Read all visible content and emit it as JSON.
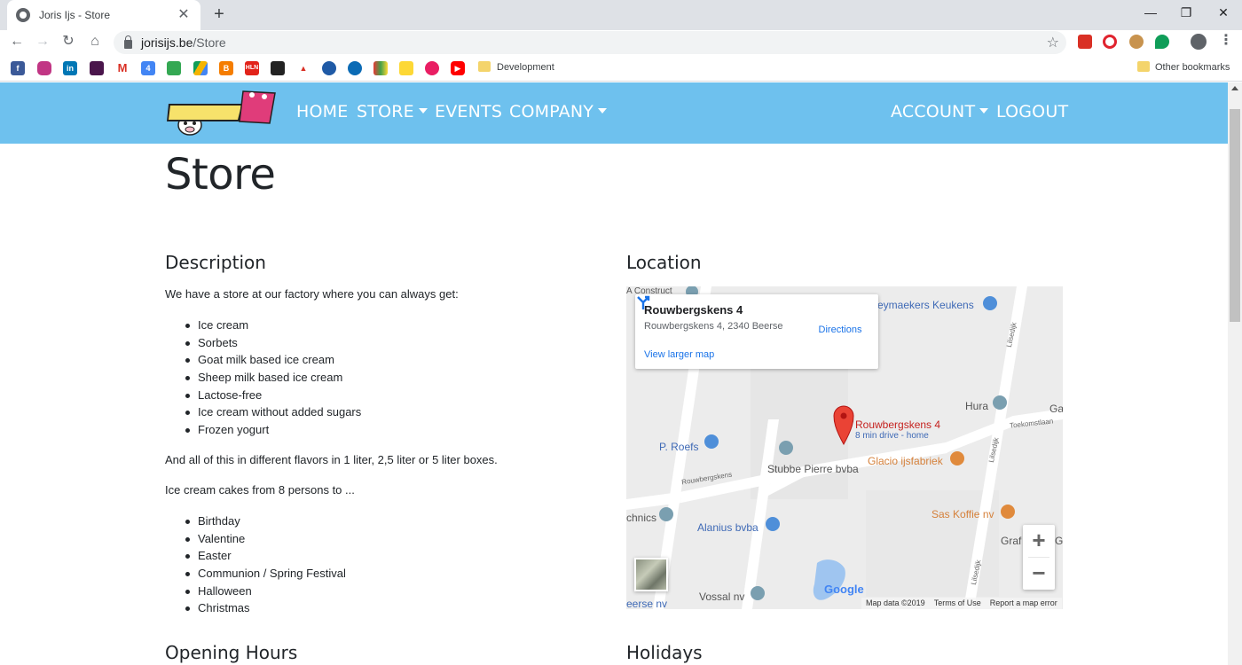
{
  "browser": {
    "tab_title": "Joris Ijs - Store",
    "tab_close": "✕",
    "new_tab": "+",
    "url_host": "jorisijs.be",
    "url_path": "/Store",
    "bookmarks": {
      "development": "Development",
      "other": "Other bookmarks"
    },
    "window": {
      "minimize": "—",
      "restore": "❐",
      "close": "✕"
    }
  },
  "site": {
    "nav": {
      "home": "HOME",
      "store": "STORE",
      "events": "EVENTS",
      "company": "COMPANY",
      "account": "ACCOUNT",
      "logout": "LOGOUT"
    },
    "page_title": "Store"
  },
  "description": {
    "heading": "Description",
    "intro": "We have a store at our factory where you can always get:",
    "items": [
      "Ice cream",
      "Sorbets",
      "Goat milk based ice cream",
      "Sheep milk based ice cream",
      "Lactose-free",
      "Ice cream without added sugars",
      "Frozen yogurt"
    ],
    "flavors": "And all of this in different flavors in 1 liter, 2,5 liter or 5 liter boxes.",
    "cakes_intro": "Ice cream cakes from 8 persons to ...",
    "cake_items": [
      "Birthday",
      "Valentine",
      "Easter",
      "Communion / Spring Festival",
      "Halloween",
      "Christmas"
    ]
  },
  "location": {
    "heading": "Location",
    "card": {
      "name": "Rouwbergskens 4",
      "address": "Rouwbergskens 4, 2340 Beerse",
      "directions": "Directions",
      "larger_map": "View larger map"
    },
    "pin_label": "Rouwbergskens 4",
    "pin_sub": "8 min drive - home",
    "pois": {
      "keukens": "eymaekers Keukens",
      "hura": "Hura",
      "ga": "Ga",
      "roefs": "P. Roefs",
      "stubbe": "Stubbe Pierre bvba",
      "glacio": "Glacio ijsfabriek",
      "chnics": "chnics",
      "alanius": "Alanius bvba",
      "sas": "Sas Koffie nv",
      "graf": "Graf",
      "gr": "Gr",
      "vossal": "Vossal nv",
      "eerse": "eerse nv",
      "construct": "A Construct"
    },
    "roads": {
      "rouwbergskens": "Rouwbergskens",
      "toekomst": "Toekomstlaan",
      "lilsedijk1": "Lilsedijk",
      "lilsedijk2": "Lilsedijk",
      "lilsedijk3": "Lilsedijk"
    },
    "google": "Google",
    "footer": {
      "data": "Map data ©2019",
      "terms": "Terms of Use",
      "report": "Report a map error"
    },
    "zoom_in": "+",
    "zoom_out": "−"
  },
  "opening_hours": {
    "heading": "Opening Hours"
  },
  "holidays": {
    "heading": "Holidays"
  },
  "colors": {
    "nav_bg": "#6ec1ee",
    "link_blue": "#1a73e8",
    "poi_blue": "#3f6ab6",
    "poi_orange": "#d5813b",
    "pin_red": "#c5221f"
  }
}
